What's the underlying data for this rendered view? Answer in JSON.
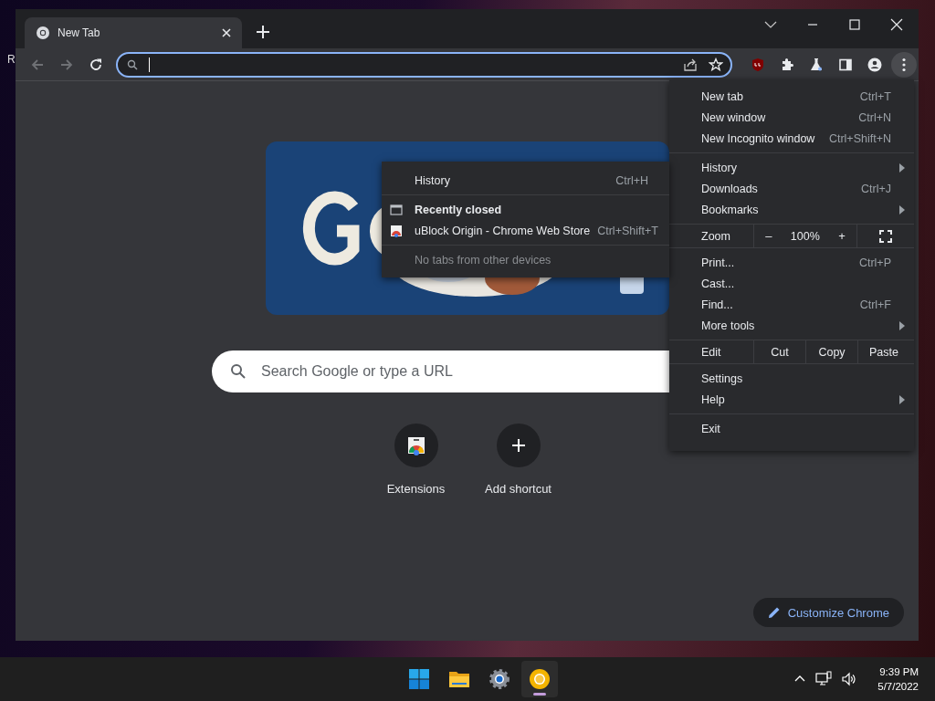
{
  "desktop": {
    "icon_label": "R"
  },
  "window": {
    "tabs": [
      {
        "title": "New Tab",
        "selected": true
      }
    ]
  },
  "new_tab_page": {
    "search": {
      "placeholder": "Search Google or type a URL"
    },
    "shortcuts": [
      {
        "label": "Extensions",
        "kind": "extension"
      },
      {
        "label": "Add shortcut",
        "kind": "add"
      }
    ],
    "customize_button": "Customize Chrome"
  },
  "history_submenu": {
    "sections": [
      [
        {
          "kind": "item",
          "label": "History",
          "shortcut": "Ctrl+H"
        }
      ],
      [
        {
          "kind": "header",
          "label": "Recently closed"
        },
        {
          "kind": "tab",
          "label": "uBlock Origin - Chrome Web Store",
          "shortcut": "Ctrl+Shift+T"
        }
      ],
      [
        {
          "kind": "note",
          "label": "No tabs from other devices"
        }
      ]
    ]
  },
  "menu": {
    "sections": [
      [
        {
          "kind": "item",
          "label": "New tab",
          "shortcut": "Ctrl+T",
          "submenu": false
        },
        {
          "kind": "item",
          "label": "New window",
          "shortcut": "Ctrl+N",
          "submenu": false
        },
        {
          "kind": "item",
          "label": "New Incognito window",
          "shortcut": "Ctrl+Shift+N",
          "submenu": false
        }
      ],
      [
        {
          "kind": "item",
          "label": "History",
          "submenu": true
        },
        {
          "kind": "item",
          "label": "Downloads",
          "shortcut": "Ctrl+J",
          "submenu": false
        },
        {
          "kind": "item",
          "label": "Bookmarks",
          "submenu": true
        }
      ],
      [
        {
          "kind": "zoom",
          "label": "Zoom",
          "minus": "–",
          "value": "100%",
          "plus": "+"
        }
      ],
      [
        {
          "kind": "item",
          "label": "Print...",
          "shortcut": "Ctrl+P",
          "submenu": false
        },
        {
          "kind": "item",
          "label": "Cast...",
          "submenu": false
        },
        {
          "kind": "item",
          "label": "Find...",
          "shortcut": "Ctrl+F",
          "submenu": false
        },
        {
          "kind": "item",
          "label": "More tools",
          "submenu": true
        }
      ],
      [
        {
          "kind": "edit",
          "label": "Edit",
          "buttons": [
            "Cut",
            "Copy",
            "Paste"
          ]
        }
      ],
      [
        {
          "kind": "item",
          "label": "Settings",
          "submenu": false
        },
        {
          "kind": "item",
          "label": "Help",
          "submenu": true
        }
      ],
      [
        {
          "kind": "item",
          "label": "Exit",
          "submenu": false
        }
      ]
    ]
  },
  "taskbar": {
    "apps": [
      {
        "kind": "start",
        "active": false
      },
      {
        "kind": "explorer",
        "active": false
      },
      {
        "kind": "settings",
        "active": false
      },
      {
        "kind": "chrome",
        "active": true
      }
    ],
    "clock": {
      "time": "9:39 PM",
      "date": "5/7/2022"
    }
  }
}
